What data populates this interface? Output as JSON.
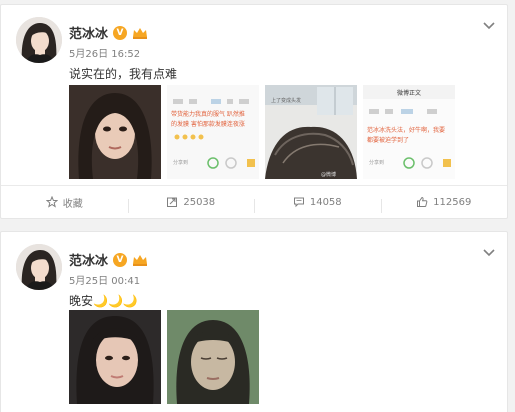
{
  "posts": [
    {
      "username": "范冰冰",
      "verified_badge": "V",
      "timestamp": "5月26日 16:52",
      "text": "说实在的，我有点难",
      "images": [
        {
          "kind": "selfie",
          "icon": "photo-icon"
        },
        {
          "kind": "screenshot",
          "lines": [
            "带货能力我真的服气 趴然推",
            "的发膜 害怕那款发膜连夜涨"
          ],
          "footer": "分享到"
        },
        {
          "kind": "hair-closeup",
          "caption": "上了变成头发",
          "footer": "@微博"
        },
        {
          "kind": "screenshot",
          "header": "微博正文",
          "lines": [
            "范冰冰洗头法，好牛啊，我要",
            "都要被迫学到了"
          ],
          "footer": "分享到"
        }
      ],
      "actions": {
        "favorite_label": "收藏",
        "repost_count": "25038",
        "comment_count": "14058",
        "like_count": "112569"
      }
    },
    {
      "username": "范冰冰",
      "verified_badge": "V",
      "timestamp": "5月25日 00:41",
      "text": "晚安🌙🌙🌙",
      "images": [
        {
          "kind": "selfie"
        },
        {
          "kind": "selfie-filtered"
        }
      ]
    }
  ],
  "colors": {
    "accent": "#f6a623",
    "muted": "#808080",
    "card_bg": "#ffffff",
    "page_bg": "#f2f2f2"
  }
}
